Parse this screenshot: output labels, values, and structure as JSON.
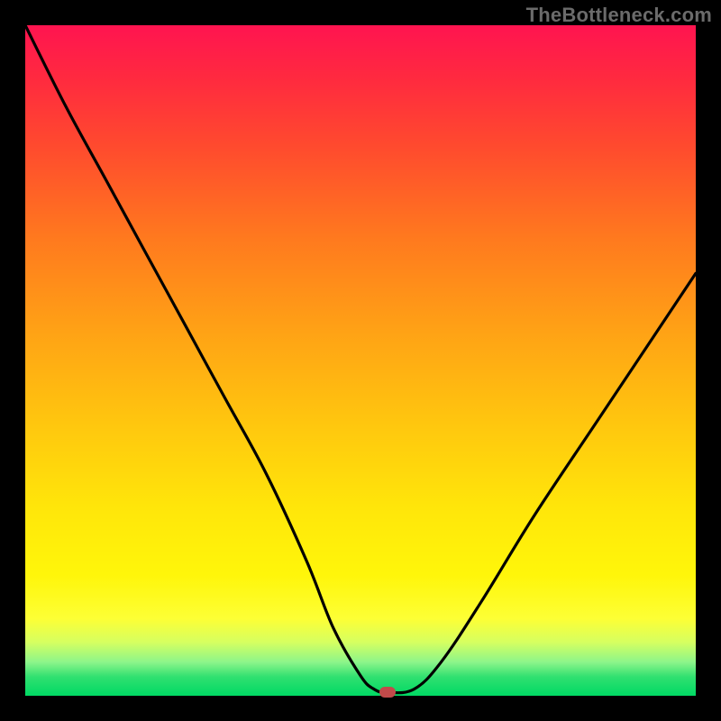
{
  "watermark": "TheBottleneck.com",
  "colors": {
    "frame": "#000000",
    "curve": "#000000",
    "marker": "#c24a4a"
  },
  "chart_data": {
    "type": "line",
    "title": "",
    "xlabel": "",
    "ylabel": "",
    "xlim": [
      0,
      100
    ],
    "ylim": [
      0,
      100
    ],
    "grid": false,
    "legend": false,
    "series": [
      {
        "name": "bottleneck-curve",
        "x": [
          0,
          6,
          12,
          18,
          24,
          30,
          36,
          42,
          46,
          50,
          52,
          54,
          58,
          62,
          68,
          76,
          86,
          100
        ],
        "y": [
          100,
          88,
          77,
          66,
          55,
          44,
          33,
          20,
          10,
          3,
          1,
          0.5,
          1,
          5,
          14,
          27,
          42,
          63
        ]
      }
    ],
    "marker": {
      "x": 54,
      "y": 0.5
    },
    "gradient_stops": [
      {
        "pos": 0,
        "color": "#ff1450"
      },
      {
        "pos": 0.18,
        "color": "#ff4a2e"
      },
      {
        "pos": 0.46,
        "color": "#ffa315"
      },
      {
        "pos": 0.72,
        "color": "#ffe60a"
      },
      {
        "pos": 0.92,
        "color": "#d6ff60"
      },
      {
        "pos": 1.0,
        "color": "#00d964"
      }
    ]
  }
}
